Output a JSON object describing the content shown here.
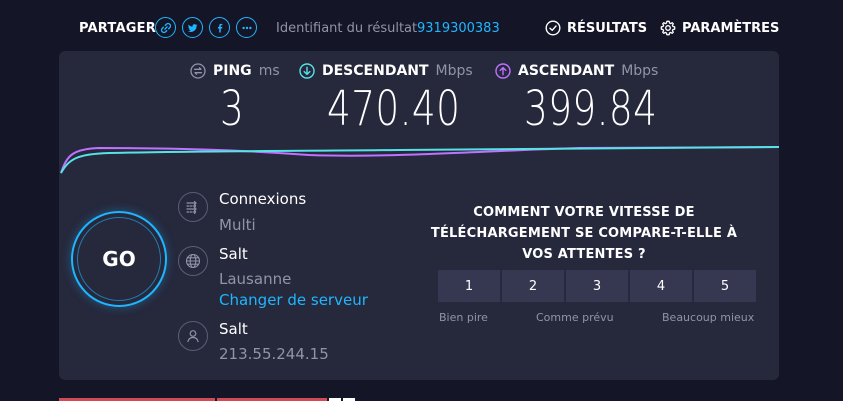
{
  "share": {
    "label": "PARTAGER",
    "icons": [
      "link-icon",
      "twitter-icon",
      "facebook-icon",
      "more-icon"
    ]
  },
  "result": {
    "id_label": "Identifiant du résultat",
    "id_value": "9319300383"
  },
  "nav": {
    "results_label": "RÉSULTATS",
    "settings_label": "PARAMÈTRES"
  },
  "metrics": {
    "ping": {
      "label": "PING",
      "unit": "ms",
      "value": "3"
    },
    "download": {
      "label": "DESCENDANT",
      "unit": "Mbps",
      "value": "470.40"
    },
    "upload": {
      "label": "ASCENDANT",
      "unit": "Mbps",
      "value": "399.84"
    }
  },
  "go_label": "GO",
  "connection": {
    "title": "Connexions",
    "value": "Multi"
  },
  "server": {
    "title": "Salt",
    "location": "Lausanne",
    "change_label": "Changer de serveur"
  },
  "provider": {
    "title": "Salt",
    "ip": "213.55.244.15"
  },
  "survey": {
    "question": "COMMENT VOTRE VITESSE DE TÉLÉCHARGEMENT SE COMPARE-T-ELLE À VOS ATTENTES ?",
    "options": [
      "1",
      "2",
      "3",
      "4",
      "5"
    ],
    "low_label": "Bien pire",
    "mid_label": "Comme prévu",
    "high_label": "Beaucoup mieux"
  },
  "colors": {
    "accent": "#1fb6ff",
    "download": "#57e2e5",
    "upload": "#bf71ff",
    "panel": "#26283c",
    "background": "#141526"
  }
}
